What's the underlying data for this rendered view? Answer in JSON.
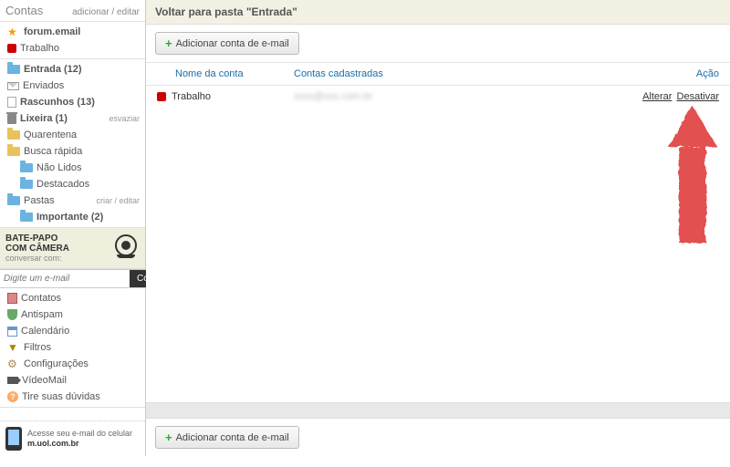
{
  "sidebar": {
    "title": "Contas",
    "title_action": "adicionar / editar",
    "accounts": [
      {
        "label": "forum.email",
        "icon": "star"
      },
      {
        "label": "Trabalho",
        "icon": "red-square"
      }
    ],
    "folders": [
      {
        "label": "Entrada (12)",
        "icon": "folder",
        "bold": true
      },
      {
        "label": "Enviados",
        "icon": "envelope"
      },
      {
        "label": "Rascunhos (13)",
        "icon": "doc",
        "bold": true
      },
      {
        "label": "Lixeira (1)",
        "icon": "trash",
        "bold": true,
        "side": "esvaziar"
      },
      {
        "label": "Quarentena",
        "icon": "folder-yellow"
      },
      {
        "label": "Busca rápida",
        "icon": "folder-yellow"
      },
      {
        "label": "Não Lidos",
        "icon": "folder",
        "sub": true
      },
      {
        "label": "Destacados",
        "icon": "folder",
        "sub": true
      },
      {
        "label": "Pastas",
        "icon": "folder",
        "side": "criar / editar"
      },
      {
        "label": "Importante (2)",
        "icon": "folder",
        "sub": true,
        "bold": true
      }
    ],
    "chat": {
      "title1": "BATE-PAPO",
      "title2": "COM CÂMERA",
      "sub": "conversar com:",
      "placeholder": "Digite um e-mail",
      "button": "Convidar"
    },
    "tools": [
      {
        "label": "Contatos",
        "icon": "book"
      },
      {
        "label": "Antispam",
        "icon": "shield"
      },
      {
        "label": "Calendário",
        "icon": "cal"
      },
      {
        "label": "Filtros",
        "icon": "funnel"
      },
      {
        "label": "Configurações",
        "icon": "gear"
      },
      {
        "label": "VídeoMail",
        "icon": "cam"
      },
      {
        "label": "Tire suas dúvidas",
        "icon": "q"
      }
    ],
    "mobile": {
      "line1": "Acesse seu e-mail do celular",
      "line2": "m.uol.com.br"
    }
  },
  "main": {
    "back_label": "Voltar para pasta \"Entrada\"",
    "add_button": "Adicionar conta de e-mail",
    "columns": {
      "c1": "Nome da conta",
      "c2": "Contas cadastradas",
      "c3": "Ação"
    },
    "rows": [
      {
        "name": "Trabalho",
        "email": "xxxx@xxx.com.br",
        "action1": "Alterar",
        "action2": "Desativar"
      }
    ]
  }
}
